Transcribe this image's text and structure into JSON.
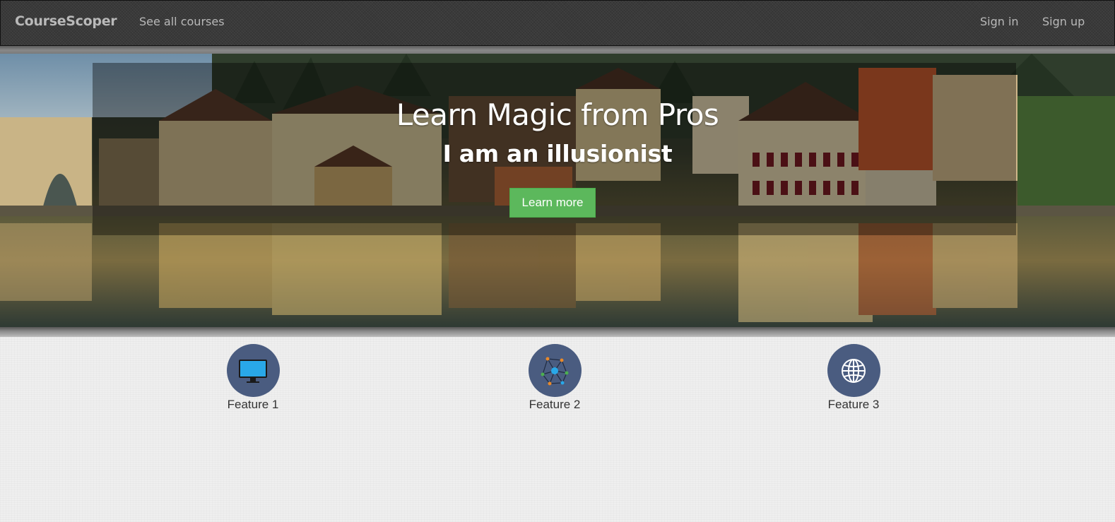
{
  "navbar": {
    "brand": "CourseScoper",
    "see_all": "See all courses",
    "sign_in": "Sign in",
    "sign_up": "Sign up"
  },
  "hero": {
    "title": "Learn Magic from Pros",
    "subtitle": "I am an illusionist",
    "button_label": "Learn more",
    "button_color": "#5cb85c"
  },
  "features": [
    {
      "label": "Feature 1",
      "icon": "monitor-icon"
    },
    {
      "label": "Feature 2",
      "icon": "network-icon"
    },
    {
      "label": "Feature 3",
      "icon": "globe-icon"
    }
  ],
  "colors": {
    "feature_circle": "#4a5c80",
    "navbar_bg": "#3a3a3a"
  }
}
